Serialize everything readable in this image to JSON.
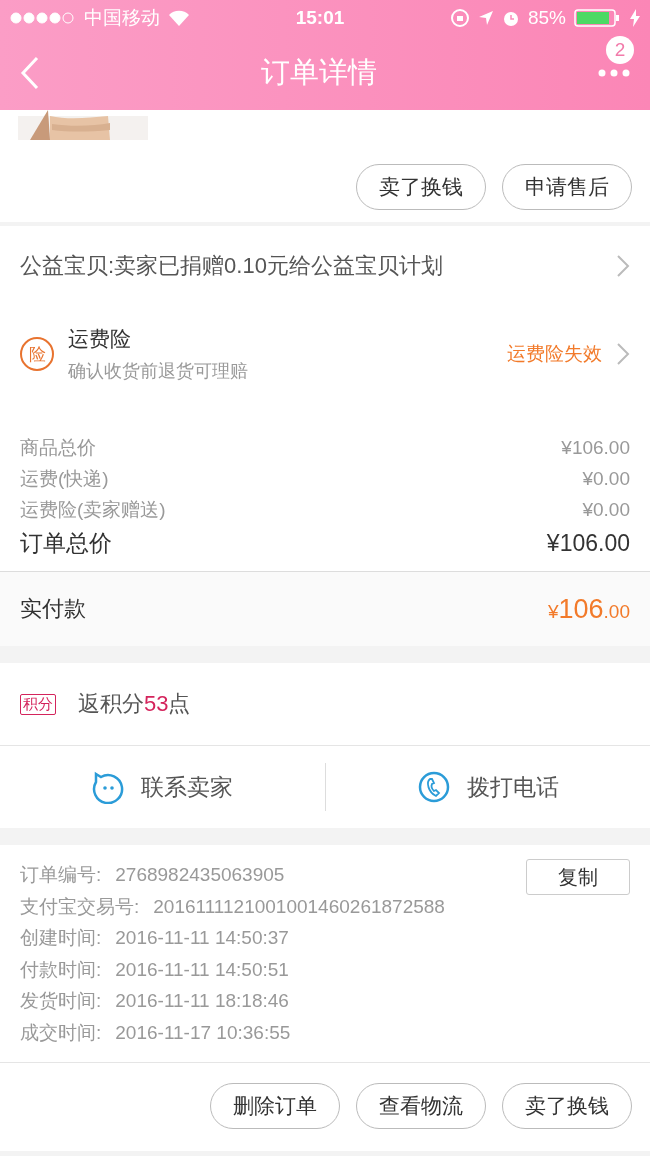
{
  "status_bar": {
    "carrier": "中国移动",
    "time": "15:01",
    "battery": "85%"
  },
  "nav": {
    "title": "订单详情",
    "badge": "2"
  },
  "product": {
    "image": {
      "kind": "picture"
    }
  },
  "product_actions": [
    "卖了换钱",
    "申请售后"
  ],
  "charity": {
    "text": "公益宝贝:卖家已捐赠0.10元给公益宝贝计划"
  },
  "insurance": {
    "icon": "险",
    "title": "运费险",
    "subtitle": "确认收货前退货可理赔",
    "status": "运费险失效"
  },
  "prices": [
    {
      "label": "商品总价",
      "value": "¥106.00"
    },
    {
      "label": "运费(快递)",
      "value": "¥0.00"
    },
    {
      "label": "运费险(卖家赠送)",
      "value": "¥0.00"
    }
  ],
  "total": {
    "label": "订单总价",
    "value": "¥106.00"
  },
  "paid": {
    "label": "实付款",
    "currency": "¥",
    "integer": "106",
    "decimal": ".00"
  },
  "points": {
    "tag": "积分",
    "before": "返积分",
    "value": "53",
    "after": "点"
  },
  "contact": [
    {
      "kind": "chat",
      "label": "联系卖家"
    },
    {
      "kind": "phone",
      "label": "拨打电话"
    }
  ],
  "order_info": {
    "copy_button": "复制",
    "rows": [
      {
        "label": "订单编号:",
        "value": "2768982435063905"
      },
      {
        "label": "支付宝交易号:",
        "value": "2016111121001001460261872588"
      },
      {
        "label": "创建时间:",
        "value": "2016-11-11 14:50:37"
      },
      {
        "label": "付款时间:",
        "value": "2016-11-11 14:50:51"
      },
      {
        "label": "发货时间:",
        "value": "2016-11-11 18:18:46"
      },
      {
        "label": "成交时间:",
        "value": "2016-11-17 10:36:55"
      }
    ]
  },
  "bottom_actions": [
    "删除订单",
    "查看物流",
    "卖了换钱"
  ]
}
